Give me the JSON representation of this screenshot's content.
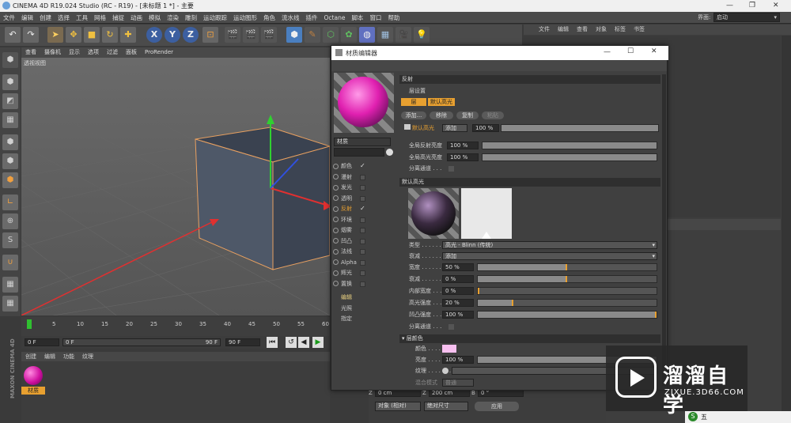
{
  "window": {
    "title": "CINEMA 4D R19.024 Studio (RC - R19) - [未标题 1 *] - 主要"
  },
  "menu": [
    "文件",
    "编辑",
    "创建",
    "选择",
    "工具",
    "网格",
    "捕捉",
    "动画",
    "模拟",
    "渲染",
    "雕刻",
    "运动跟踪",
    "运动图形",
    "角色",
    "流水线",
    "插件",
    "Octane",
    "脚本",
    "窗口",
    "帮助"
  ],
  "layout": {
    "label": "界面:",
    "value": "启动"
  },
  "viewport": {
    "menu": [
      "查看",
      "摄像机",
      "显示",
      "选项",
      "过滤",
      "面板",
      "ProRender"
    ],
    "label": "透视视图"
  },
  "timeline": {
    "ticks": [
      "0",
      "5",
      "10",
      "15",
      "20",
      "25",
      "30",
      "35",
      "40",
      "45",
      "50",
      "55",
      "60"
    ],
    "start": "0 F",
    "current": "0 F",
    "end": "90 F",
    "end2": "90 F"
  },
  "material_manager": {
    "menu": [
      "创建",
      "编辑",
      "功能",
      "纹理"
    ],
    "material_name": "材质"
  },
  "object_manager": {
    "menu": [
      "文件",
      "编辑",
      "查看",
      "对象",
      "标签",
      "书签"
    ]
  },
  "coords": {
    "z_label": "Z",
    "z_value": "0 cm",
    "sz_label": "Z",
    "sz_value": "200 cm",
    "b_label": "B",
    "b_value": "0 °",
    "mode1": "对象 (相对)",
    "mode2": "绝对尺寸",
    "apply": "应用"
  },
  "mat_editor": {
    "title": "材质编辑器",
    "name_field": "材质",
    "channels": [
      {
        "label": "颜色",
        "checked": true
      },
      {
        "label": "漫射",
        "checked": false
      },
      {
        "label": "发光",
        "checked": false
      },
      {
        "label": "透明",
        "checked": false
      },
      {
        "label": "反射",
        "checked": true,
        "active": true
      },
      {
        "label": "环境",
        "checked": false
      },
      {
        "label": "烟雾",
        "checked": false
      },
      {
        "label": "凹凸",
        "checked": false
      },
      {
        "label": "法线",
        "checked": false
      },
      {
        "label": "Alpha",
        "checked": false
      },
      {
        "label": "辉光",
        "checked": false
      },
      {
        "label": "置换",
        "checked": false
      }
    ],
    "extra": [
      "编辑",
      "光照",
      "指定"
    ],
    "section_reflect": "反射",
    "layer_settings": "层设置",
    "tab_layer": "层",
    "tab_default": "默认高光",
    "btn_add": "添加...",
    "btn_remove": "移除",
    "btn_copy": "复制",
    "btn_paste": "粘贴",
    "layer_name": "默认高光",
    "layer_mode": "添加",
    "layer_pct": "100 %",
    "global_reflect_label": "全局反射亮度",
    "global_reflect_val": "100 %",
    "global_spec_label": "全局高光亮度",
    "global_spec_val": "100 %",
    "sep_pass1": "分离通道 . . .",
    "section_spec": "默认高光",
    "type_label": "类型 . . . . . . . .",
    "type_val": "高光 - Blinn (传统)",
    "atten_label": "衰减 . . . . . . . .",
    "atten_val": "添加",
    "params": [
      {
        "label": "宽度 . . . . . .",
        "val": "50 %",
        "fill": 0.5
      },
      {
        "label": "衰减 . . . . . .",
        "val": "0 %",
        "fill": 0.5
      },
      {
        "label": "内部宽度 . . .",
        "val": "0 %",
        "fill": 0.0
      },
      {
        "label": "高光强度 . . .",
        "val": "20 %",
        "fill": 0.2
      },
      {
        "label": "凹凸强度 . . .",
        "val": "100 %",
        "fill": 1.0
      }
    ],
    "sep_pass2": "分离通道 . . .",
    "section_layer_color": "层颜色",
    "color_label": "颜色 . . . . . .",
    "bright_label": "亮度 . . . . . .",
    "bright_val": "100 %",
    "texture_label": "纹理 . . . . . . .",
    "blend_label": "混合模式",
    "blend_val": "普通"
  },
  "watermark": {
    "brand": "溜溜自学",
    "url": "ZIXUE.3D66.COM"
  },
  "side_brand": "MAXON CINEMA 4D",
  "tray": {
    "ime": "五"
  }
}
